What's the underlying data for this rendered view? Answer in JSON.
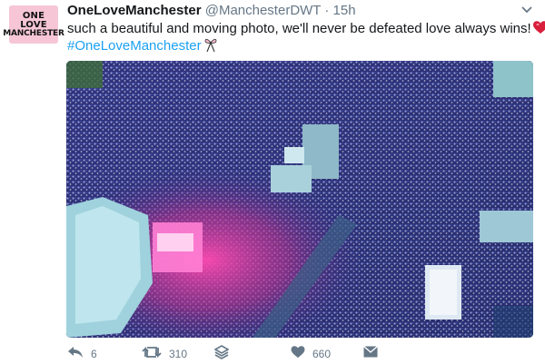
{
  "tweet": {
    "avatar": {
      "line1": "ONE LOVE",
      "line2": "MANCHESTER",
      "icon": "avatar-logo"
    },
    "display_name": "OneLoveManchester",
    "handle": "@ManchesterDWT",
    "separator": "·",
    "time": "15h",
    "text": "such a beautiful and moving photo, we'll never be defeated love always wins!",
    "text_emoji": "red-heart-emoji",
    "hashtag": "#OneLoveManchester",
    "hashtag_emoji": "bow-emoji",
    "media": {
      "type": "photo",
      "icon": "concert-crowd-photo"
    },
    "actions": {
      "reply": {
        "icon": "reply-icon",
        "count": "6"
      },
      "retweet": {
        "icon": "retweet-icon",
        "count": "310"
      },
      "stack": {
        "icon": "stack-icon"
      },
      "like": {
        "icon": "heart-icon",
        "count": "660"
      },
      "dm": {
        "icon": "envelope-icon"
      }
    },
    "dropdown_icon": "chevron-down-icon"
  },
  "colors": {
    "link": "#1da1f2",
    "muted": "#657786",
    "text": "#14171a",
    "avatar_bg": "#f6c6d6",
    "heart": "#e0245e"
  }
}
